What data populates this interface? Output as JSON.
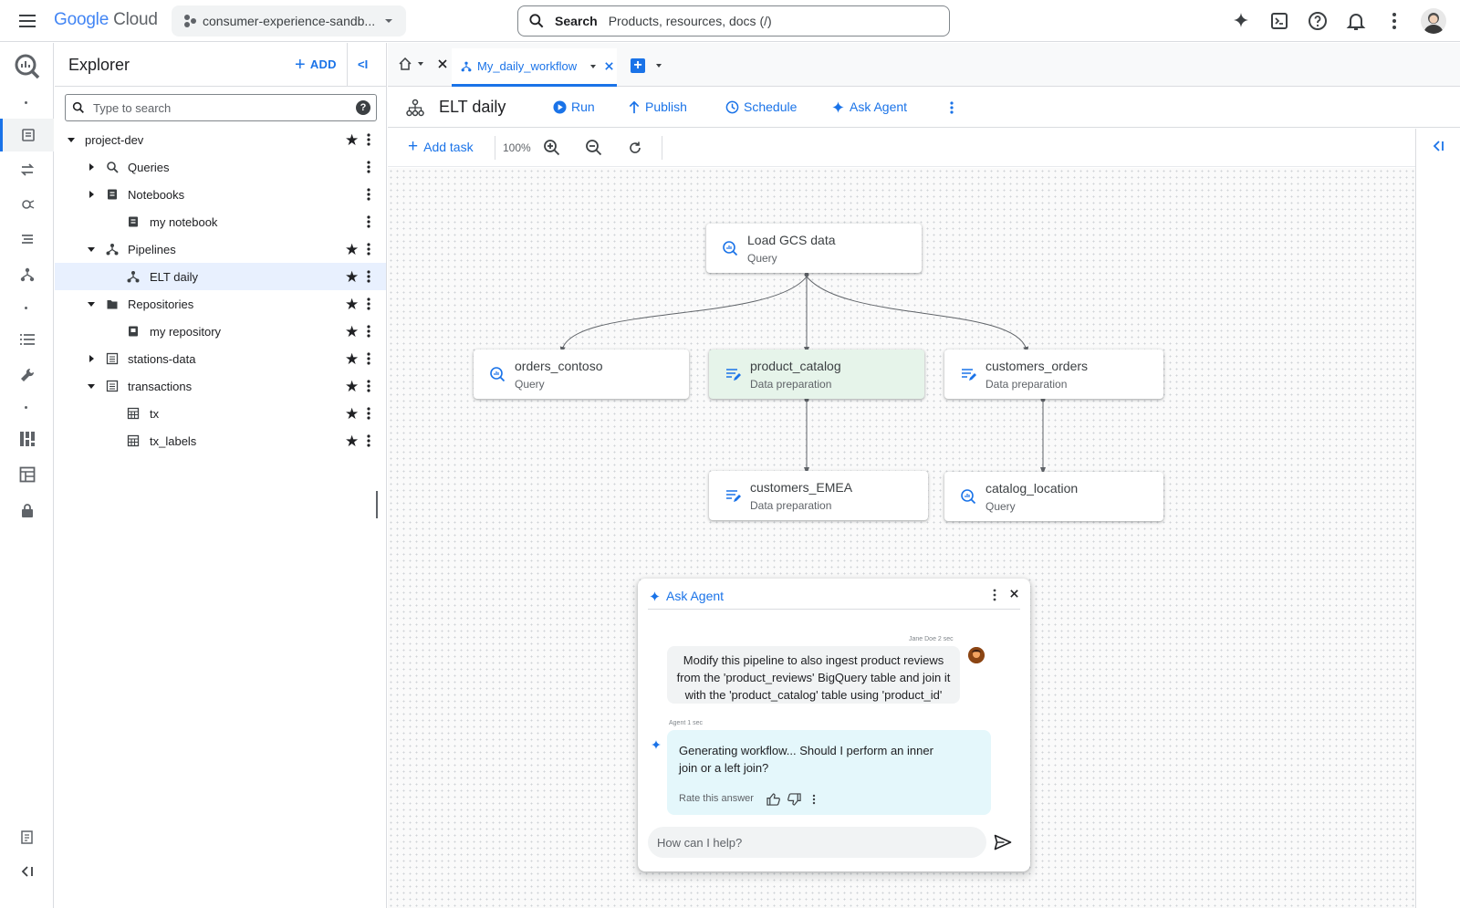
{
  "topbar": {
    "logo_google": "Google",
    "logo_cloud": "Cloud",
    "project_name": "consumer-experience-sandb...",
    "search_label": "Search",
    "search_placeholder": "Products, resources, docs (/)"
  },
  "explorer": {
    "title": "Explorer",
    "add_label": "ADD",
    "collapse_label": "<I",
    "search_placeholder": "Type to search",
    "tree": [
      {
        "label": "project-dev",
        "icon": "none",
        "starred": true
      },
      {
        "label": "Queries",
        "icon": "query-icon",
        "starred": false
      },
      {
        "label": "Notebooks",
        "icon": "notebook-icon",
        "starred": false
      },
      {
        "label": "my notebook",
        "icon": "notebook-icon",
        "starred": false
      },
      {
        "label": "Pipelines",
        "icon": "pipeline-icon",
        "starred": true
      },
      {
        "label": "ELT daily",
        "icon": "pipeline-icon",
        "starred": true,
        "selected": true
      },
      {
        "label": "Repositories",
        "icon": "folder-icon",
        "starred": true
      },
      {
        "label": "my repository",
        "icon": "repository-icon",
        "starred": true
      },
      {
        "label": "stations-data",
        "icon": "dataset-icon",
        "starred": true
      },
      {
        "label": "transactions",
        "icon": "dataset-icon",
        "starred": true
      },
      {
        "label": "tx",
        "icon": "table-icon",
        "starred": true
      },
      {
        "label": "tx_labels",
        "icon": "table-icon",
        "starred": true
      }
    ]
  },
  "tabs": {
    "active_label": "My_daily_workflow"
  },
  "workflow": {
    "title": "ELT daily",
    "run_label": "Run",
    "publish_label": "Publish",
    "schedule_label": "Schedule",
    "ask_agent_label": "Ask Agent"
  },
  "canvas_toolbar": {
    "add_task_label": "Add task",
    "zoom_level": "100%"
  },
  "nodes": {
    "load_gcs": {
      "title": "Load GCS data",
      "type": "Query"
    },
    "orders_contoso": {
      "title": "orders_contoso",
      "type": "Query"
    },
    "product_catalog": {
      "title": "product_catalog",
      "type": "Data preparation"
    },
    "customers_orders": {
      "title": "customers_orders",
      "type": "Data preparation"
    },
    "customers_emea": {
      "title": "customers_EMEA",
      "type": "Data preparation"
    },
    "catalog_location": {
      "title": "catalog_location",
      "type": "Query"
    }
  },
  "agent_panel": {
    "title": "Ask Agent",
    "user_meta": "Jane Doe  2 sec",
    "user_message": "Modify this pipeline to also ingest product reviews from the 'product_reviews' BigQuery table and join it with the 'product_catalog' table using 'product_id'",
    "agent_meta": "Agent  1 sec",
    "agent_message": "Generating workflow... Should I perform an inner join or a left join?",
    "rate_label": "Rate this answer",
    "input_placeholder": "How can I help?"
  },
  "colors": {
    "accent": "#1a73e8",
    "highlight_node": "#e6f4ea",
    "agent_bubble": "#e4f7fb"
  }
}
